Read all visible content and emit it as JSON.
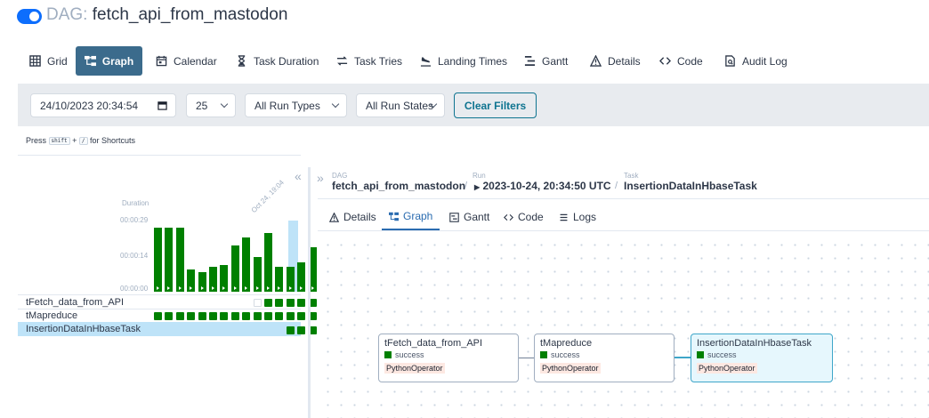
{
  "header": {
    "prefix": "DAG:",
    "dag_name": "fetch_api_from_mastodon"
  },
  "nav": {
    "grid": "Grid",
    "graph": "Graph",
    "calendar": "Calendar",
    "task_duration": "Task Duration",
    "task_tries": "Task Tries",
    "landing_times": "Landing Times",
    "gantt": "Gantt",
    "details": "Details",
    "code": "Code",
    "audit_log": "Audit Log",
    "active": "graph"
  },
  "filters": {
    "datetime": "24/10/2023  20:34:54",
    "num_runs": "25",
    "run_types": "All Run Types",
    "run_states": "All Run States",
    "clear": "Clear Filters"
  },
  "shortcut_hint": {
    "prefix": "Press",
    "key1": "shift",
    "plus": "+",
    "key2": "/",
    "suffix": "for Shortcuts"
  },
  "grid": {
    "duration_label": "Duration",
    "y_ticks": [
      "00:00:29",
      "00:00:14",
      "00:00:00"
    ],
    "date_label": "Oct 24, 19:04",
    "run_durations_sec": [
      26,
      26,
      26,
      9,
      8,
      10,
      11,
      19,
      22,
      14,
      24,
      10,
      10,
      12,
      18
    ],
    "tasks": [
      {
        "label": "tFetch_data_from_API",
        "first_run": 10
      },
      {
        "label": "tMapreduce",
        "first_run": 0
      },
      {
        "label": "InsertionDataInHbaseTask",
        "first_run": 12
      }
    ],
    "selected_task": "InsertionDataInHbaseTask"
  },
  "details": {
    "dag_label": "DAG",
    "dag_value": "fetch_api_from_mastodon",
    "run_label": "Run",
    "run_value": "2023-10-24, 20:34:50 UTC",
    "task_label": "Task",
    "task_value": "InsertionDataInHbaseTask",
    "sep": "/",
    "tabs": {
      "details": "Details",
      "graph": "Graph",
      "gantt": "Gantt",
      "code": "Code",
      "logs": "Logs"
    }
  },
  "graph": {
    "nodes": [
      {
        "name": "tFetch_data_from_API",
        "state": "success",
        "operator": "PythonOperator"
      },
      {
        "name": "tMapreduce",
        "state": "success",
        "operator": "PythonOperator"
      },
      {
        "name": "InsertionDataInHbaseTask",
        "state": "success",
        "operator": "PythonOperator"
      }
    ]
  },
  "colors": {
    "success": "#008000",
    "primary": "#3b6b8c",
    "toggle": "#0d6efd",
    "selected": "#bee3f8"
  }
}
